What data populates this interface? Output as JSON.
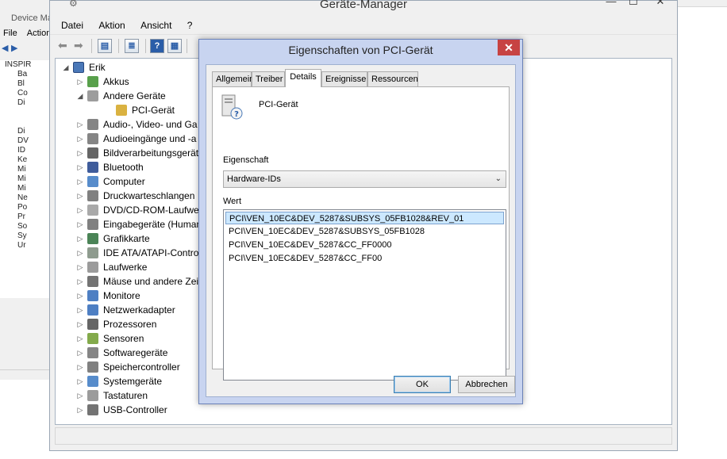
{
  "background_window": {
    "title": "Device Manag",
    "menu": [
      "File",
      "Action"
    ],
    "tree_items": [
      "INSPIR",
      "Ba",
      "Bl",
      "Co",
      "Di",
      "",
      "",
      "Di",
      "DV",
      "ID",
      "Ke",
      "Mi",
      "Mi",
      "Mi",
      "Ne",
      "Po",
      "Pr",
      "So",
      "Sy",
      "Ur"
    ]
  },
  "main_window": {
    "title": "Geräte-Manager",
    "controls": {
      "minimize": "—",
      "maximize": "☐",
      "close": "✕"
    },
    "menu": [
      "Datei",
      "Aktion",
      "Ansicht",
      "?"
    ],
    "tree": {
      "root": "Erik",
      "items": [
        {
          "label": "Akkus",
          "icon": "battery-icon",
          "color": "#3b8f2c"
        },
        {
          "label": "Andere Geräte",
          "icon": "other-devices-icon",
          "color": "#8c8c8c",
          "expanded": true
        },
        {
          "label": "PCI-Gerät",
          "icon": "unknown-device-icon",
          "color": "#d4a520",
          "child": true
        },
        {
          "label": "Audio-, Video- und Ga",
          "icon": "speaker-icon",
          "color": "#707070"
        },
        {
          "label": "Audioeingänge und -a",
          "icon": "speaker-icon",
          "color": "#707070"
        },
        {
          "label": "Bildverarbeitungsgerät",
          "icon": "camera-icon",
          "color": "#4a4a4a"
        },
        {
          "label": "Bluetooth",
          "icon": "bluetooth-icon",
          "color": "#1d3f8a"
        },
        {
          "label": "Computer",
          "icon": "computer-icon",
          "color": "#3a78c2"
        },
        {
          "label": "Druckwarteschlangen",
          "icon": "printer-icon",
          "color": "#6a6a6a"
        },
        {
          "label": "DVD/CD-ROM-Laufwe",
          "icon": "disc-drive-icon",
          "color": "#9a9a9a"
        },
        {
          "label": "Eingabegeräte (Human",
          "icon": "hid-icon",
          "color": "#6a6a6a"
        },
        {
          "label": "Grafikkarte",
          "icon": "display-adapter-icon",
          "color": "#2b6e3a"
        },
        {
          "label": "IDE ATA/ATAPI-Contro",
          "icon": "ide-controller-icon",
          "color": "#7a8a7a"
        },
        {
          "label": "Laufwerke",
          "icon": "disk-drive-icon",
          "color": "#8a8a8a"
        },
        {
          "label": "Mäuse und andere Zei",
          "icon": "mouse-icon",
          "color": "#5a5a5a"
        },
        {
          "label": "Monitore",
          "icon": "monitor-icon",
          "color": "#2f68b8"
        },
        {
          "label": "Netzwerkadapter",
          "icon": "network-icon",
          "color": "#2f68b8"
        },
        {
          "label": "Prozessoren",
          "icon": "processor-icon",
          "color": "#4a4a4a"
        },
        {
          "label": "Sensoren",
          "icon": "sensor-icon",
          "color": "#6d9b2b"
        },
        {
          "label": "Softwaregeräte",
          "icon": "software-device-icon",
          "color": "#707070"
        },
        {
          "label": "Speichercontroller",
          "icon": "storage-controller-icon",
          "color": "#6a6a6a"
        },
        {
          "label": "Systemgeräte",
          "icon": "system-device-icon",
          "color": "#3a78c2"
        },
        {
          "label": "Tastaturen",
          "icon": "keyboard-icon",
          "color": "#8a8a8a"
        },
        {
          "label": "USB-Controller",
          "icon": "usb-icon",
          "color": "#5a5a5a"
        }
      ]
    }
  },
  "dialog": {
    "title": "Eigenschaften von PCI-Gerät",
    "close_label": "✕",
    "tabs": [
      "Allgemein",
      "Treiber",
      "Details",
      "Ereignisse",
      "Ressourcen"
    ],
    "active_tab": "Details",
    "device_name": "PCI-Gerät",
    "property_label": "Eigenschaft",
    "property_value": "Hardware-IDs",
    "value_label": "Wert",
    "values": [
      "PCI\\VEN_10EC&DEV_5287&SUBSYS_05FB1028&REV_01",
      "PCI\\VEN_10EC&DEV_5287&SUBSYS_05FB1028",
      "PCI\\VEN_10EC&DEV_5287&CC_FF0000",
      "PCI\\VEN_10EC&DEV_5287&CC_FF00"
    ],
    "selected_value_index": 0,
    "ok_label": "OK",
    "cancel_label": "Abbrechen"
  }
}
